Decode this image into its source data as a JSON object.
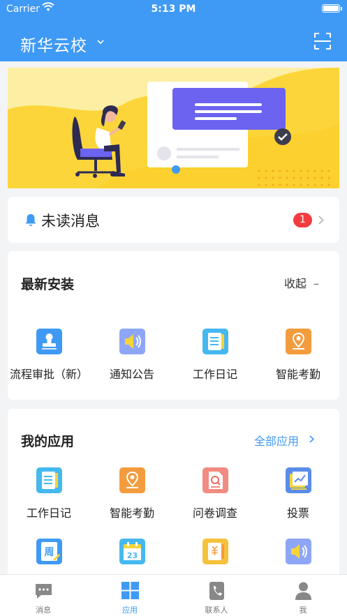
{
  "status_bar": {
    "carrier": "Carrier",
    "time": "5:13 PM"
  },
  "header": {
    "school_name": "新华云校",
    "icons": [
      "chevron-down-icon",
      "scan-icon"
    ]
  },
  "unread": {
    "label": "未读消息",
    "count": "1"
  },
  "recent": {
    "title": "最新安装",
    "collapse_label": "收起",
    "collapse_symbol": "–",
    "apps": [
      {
        "label": "流程审批（新）",
        "icon": "stamp-icon"
      },
      {
        "label": "通知公告",
        "icon": "speaker-icon"
      },
      {
        "label": "工作日记",
        "icon": "notebook-icon"
      },
      {
        "label": "智能考勤",
        "icon": "location-pin-icon"
      }
    ]
  },
  "my_apps": {
    "title": "我的应用",
    "all_label": "全部应用",
    "apps": [
      {
        "label": "工作日记",
        "icon": "notebook-icon"
      },
      {
        "label": "智能考勤",
        "icon": "location-pin-icon"
      },
      {
        "label": "问卷调查",
        "icon": "survey-icon"
      },
      {
        "label": "投票",
        "icon": "vote-chart-icon"
      },
      {
        "label": "",
        "icon": "weekly-report-icon",
        "icon_text": "周"
      },
      {
        "label": "",
        "icon": "calendar-icon",
        "icon_text": "23"
      },
      {
        "label": "",
        "icon": "salary-icon"
      },
      {
        "label": "",
        "icon": "speaker-icon"
      }
    ]
  },
  "tabbar": {
    "tabs": [
      {
        "label": "消息",
        "icon": "message-icon",
        "active": false
      },
      {
        "label": "应用",
        "icon": "apps-grid-icon",
        "active": true
      },
      {
        "label": "联系人",
        "icon": "contacts-icon",
        "active": false
      },
      {
        "label": "我",
        "icon": "profile-icon",
        "active": false
      }
    ]
  },
  "colors": {
    "primary": "#3f9af5",
    "badge": "#f23c40",
    "banner_yellow": "#fbd53a",
    "banner_purple": "#6c63f0"
  }
}
